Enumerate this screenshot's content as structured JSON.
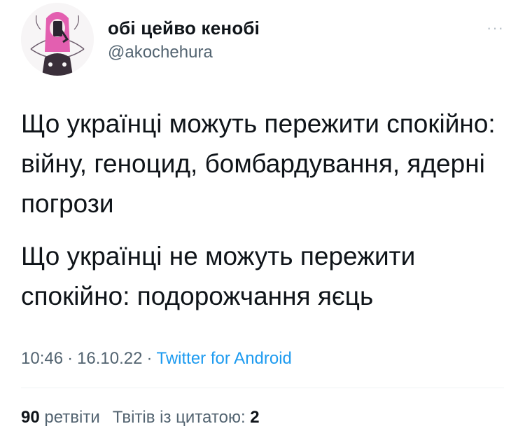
{
  "author": {
    "display_name": "обі цейво кенобі",
    "handle": "@akochehura",
    "avatar_icon": "profile-avatar"
  },
  "more_icon": "more-options-icon",
  "more_label": "···",
  "tweet": {
    "paragraphs": [
      "Що українці можуть пережити спокійно: війну, геноцид, бомбардування, ядерні погрози",
      "Що українці не можуть пережити спокійно: подорожчання яєць"
    ]
  },
  "meta": {
    "time": "10:46",
    "separator": "·",
    "date": "16.10.22",
    "source": "Twitter for Android"
  },
  "stats": {
    "retweets_count": "90",
    "retweets_label": "ретвіти",
    "quotes_label": "Твітів із цитатою:",
    "quotes_count": "2"
  },
  "colors": {
    "text": "#0f1419",
    "secondary": "#536471",
    "link": "#1d9bf0",
    "avatar_accent": "#e35fb0"
  }
}
